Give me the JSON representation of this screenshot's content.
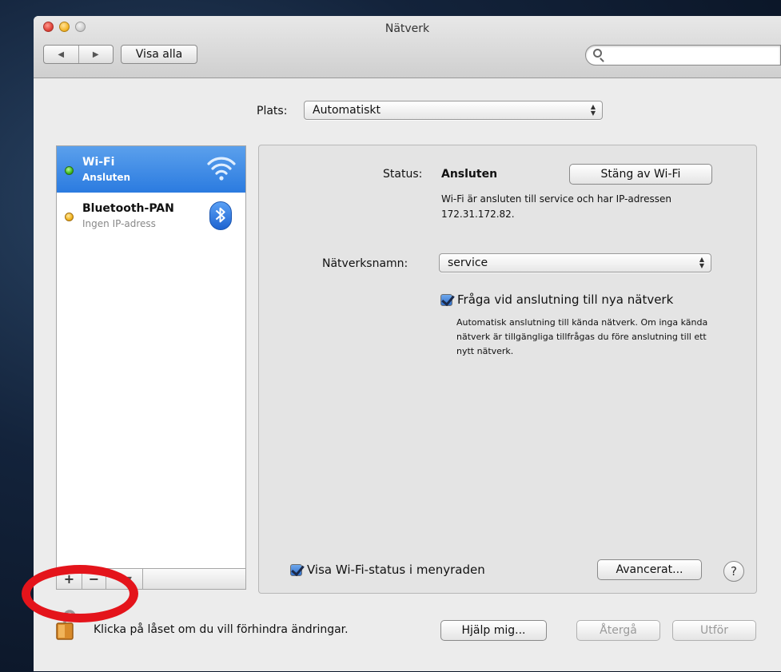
{
  "window": {
    "title": "Nätverk"
  },
  "toolbar": {
    "back_glyph": "◀",
    "forward_glyph": "▶",
    "show_all_label": "Visa alla",
    "search_placeholder": ""
  },
  "location": {
    "label": "Plats:",
    "value": "Automatiskt"
  },
  "services": [
    {
      "name": "Wi-Fi",
      "status": "Ansluten",
      "status_color": "#3dbb1c",
      "icon": "wifi-icon"
    },
    {
      "name": "Bluetooth-PAN",
      "status": "Ingen IP-adress",
      "status_color": "#f0b21c",
      "icon": "bluetooth-icon"
    }
  ],
  "sidebar_actions": {
    "add": "+",
    "remove": "−",
    "gear": "✲▾"
  },
  "detail": {
    "status_label": "Status:",
    "status_value": "Ansluten",
    "turn_off_button": "Stäng av Wi-Fi",
    "status_description": "Wi-Fi är ansluten till service och har IP-adressen 172.31.172.82.",
    "network_name_label": "Nätverksnamn:",
    "network_name_value": "service",
    "ask_to_join_label": "Fråga vid anslutning till nya nätverk",
    "ask_to_join_checked": true,
    "ask_to_join_description": "Automatisk anslutning till kända nätverk. Om inga kända nätverk är tillgängliga tillfrågas du före anslutning till ett nytt nätverk.",
    "show_menubar_label": "Visa Wi-Fi-status i menyraden",
    "show_menubar_checked": true,
    "advanced_button": "Avancerat...",
    "help_glyph": "?"
  },
  "footer": {
    "lock_text": "Klicka på låset om du vill förhindra ändringar.",
    "assist_button": "Hjälp mig...",
    "revert_button": "Återgå",
    "apply_button": "Utför"
  },
  "colors": {
    "selection": "#2b7be0",
    "annotation_ring": "#e4141b"
  }
}
